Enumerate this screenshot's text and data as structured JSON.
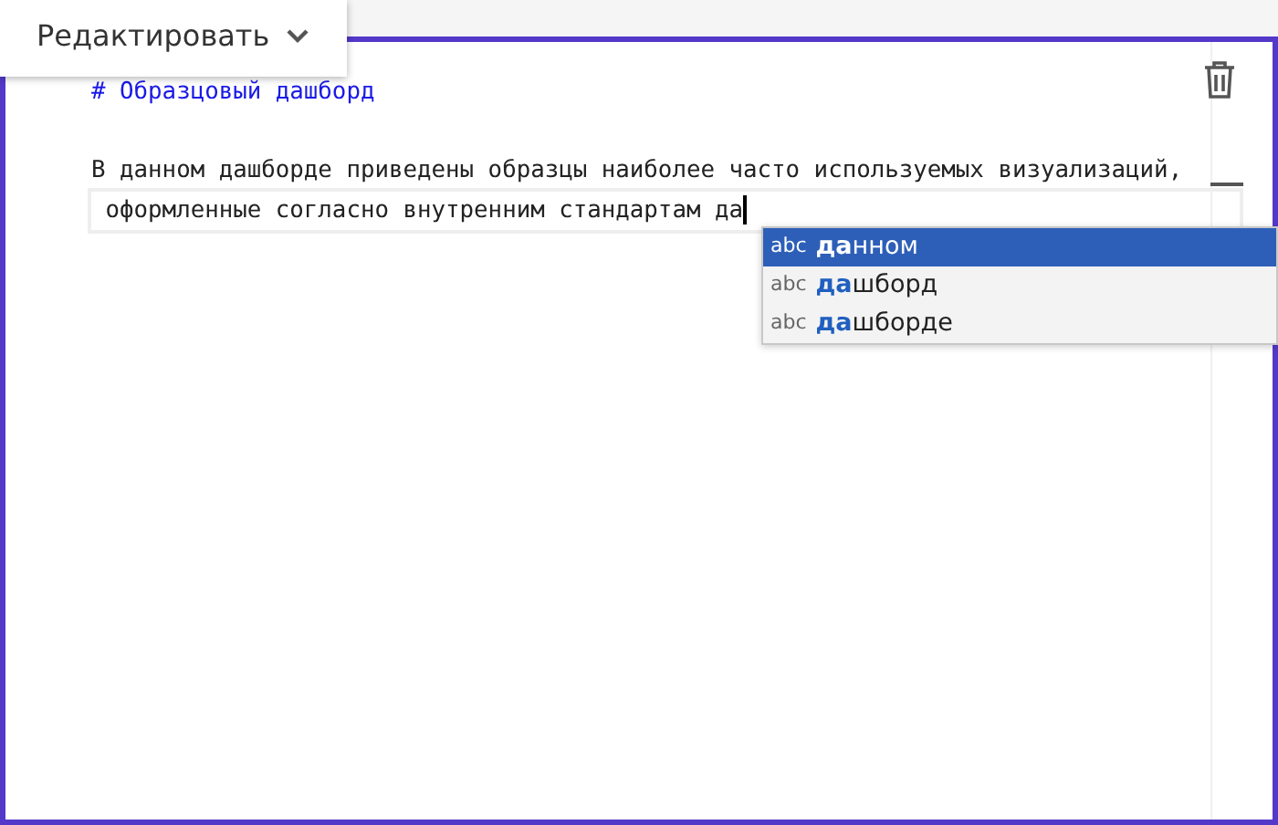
{
  "edit_menu": {
    "label": "Редактировать"
  },
  "editor": {
    "lines": [
      {
        "kind": "heading",
        "text": "# Образцовый дашборд",
        "current": false
      },
      {
        "kind": "blank",
        "current": false
      },
      {
        "kind": "text",
        "text": "В данном дашборде приведены образцы наиболее часто используемых визуализаций,",
        "current": false
      },
      {
        "kind": "text",
        "text": " оформленные согласно внутренним стандартам да",
        "current": true
      }
    ]
  },
  "suggestions": [
    {
      "icon_text": "abc",
      "label": "**да**нном",
      "selected": true
    },
    {
      "icon_text": "abc",
      "label": "**да**шборд",
      "selected": false
    },
    {
      "icon_text": "abc",
      "label": "**да**шборде",
      "selected": false
    }
  ]
}
